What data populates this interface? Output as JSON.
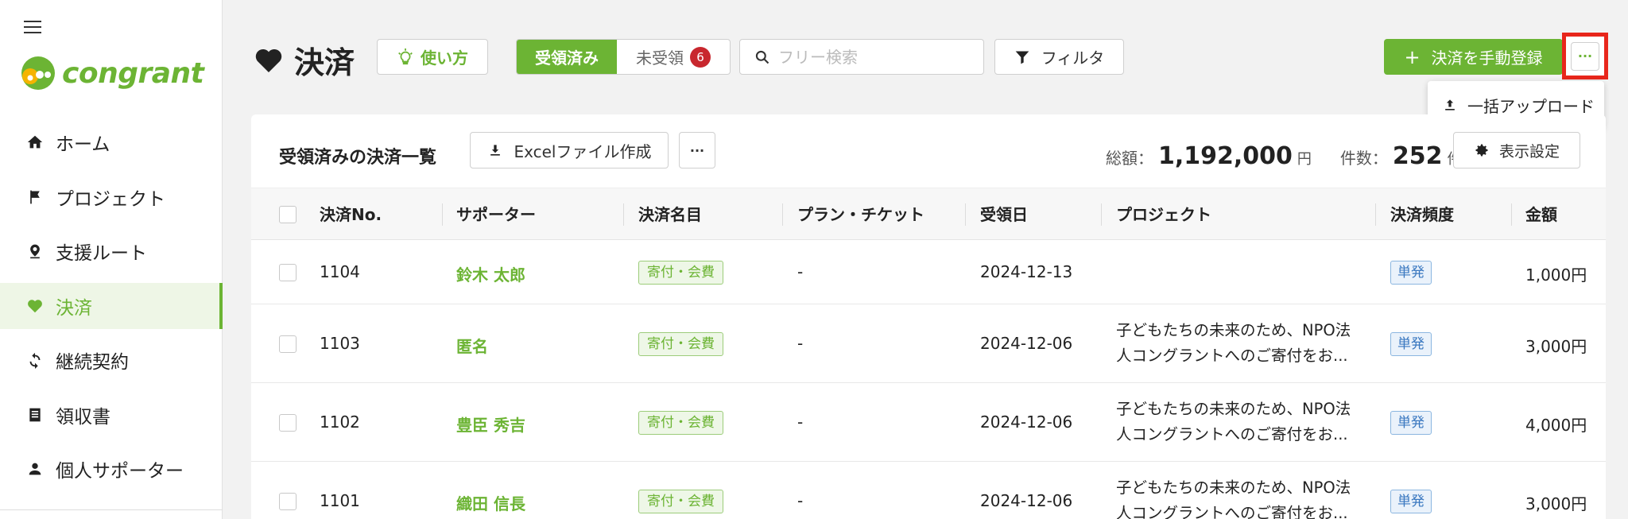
{
  "brand": {
    "name": "congrant",
    "accent": "#6cb434"
  },
  "sidebar": {
    "items": [
      {
        "label": "ホーム",
        "icon": "home-icon"
      },
      {
        "label": "プロジェクト",
        "icon": "flag-icon"
      },
      {
        "label": "支援ルート",
        "icon": "location-pin-icon"
      },
      {
        "label": "決済",
        "icon": "heart-icon",
        "active": true
      },
      {
        "label": "継続契約",
        "icon": "refresh-icon"
      },
      {
        "label": "領収書",
        "icon": "receipt-icon"
      },
      {
        "label": "個人サポーター",
        "icon": "person-icon"
      }
    ]
  },
  "header": {
    "title": "決済",
    "howto_label": "使い方",
    "tab_received": "受領済み",
    "tab_unreceived": "未受領",
    "unreceived_count": "6",
    "search_placeholder": "フリー検索",
    "filter_label": "フィルタ",
    "add_label": "決済を手動登録",
    "more_label": "···",
    "dropdown_upload": "一括アップロード"
  },
  "card": {
    "title": "受領済みの決済一覧",
    "excel_label": "Excelファイル作成",
    "more_label": "···",
    "total_label": "総額：",
    "total_value": "1,192,000",
    "total_unit": "円",
    "count_label": "件数：",
    "count_value": "252",
    "count_unit": "件",
    "display_label": "表示設定"
  },
  "table": {
    "headers": {
      "no": "決済No.",
      "supporter": "サポーター",
      "item": "決済名目",
      "plan": "プラン・チケット",
      "date": "受領日",
      "project": "プロジェクト",
      "frequency": "決済頻度",
      "amount": "金額"
    },
    "rows": [
      {
        "no": "1104",
        "supporter": "鈴木 太郎",
        "item": "寄付・会費",
        "plan": "-",
        "date": "2024-12-13",
        "project_line1": "",
        "project_line2": "",
        "frequency": "単発",
        "amount": "1,000円"
      },
      {
        "no": "1103",
        "supporter": "匿名",
        "item": "寄付・会費",
        "plan": "-",
        "date": "2024-12-06",
        "project_line1": "子どもたちの未来のため、NPO法",
        "project_line2": "人コングラントへのご寄付をお...",
        "frequency": "単発",
        "amount": "3,000円"
      },
      {
        "no": "1102",
        "supporter": "豊臣 秀吉",
        "item": "寄付・会費",
        "plan": "-",
        "date": "2024-12-06",
        "project_line1": "子どもたちの未来のため、NPO法",
        "project_line2": "人コングラントへのご寄付をお...",
        "frequency": "単発",
        "amount": "4,000円"
      },
      {
        "no": "1101",
        "supporter": "織田 信長",
        "item": "寄付・会費",
        "plan": "-",
        "date": "2024-12-06",
        "project_line1": "子どもたちの未来のため、NPO法",
        "project_line2": "人コングラントへのご寄付をお...",
        "frequency": "単発",
        "amount": "3,000円"
      }
    ]
  }
}
